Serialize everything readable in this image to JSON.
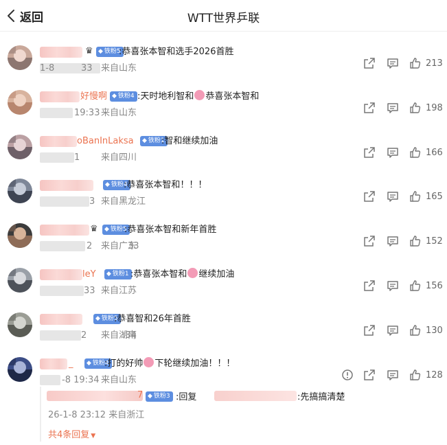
{
  "header": {
    "back_label": "返回",
    "title": "WTT世界乒联"
  },
  "comments": [
    {
      "name_visible": "",
      "fan_badge": "铁粉5",
      "text": ":恭喜张本智和选手2026首胜",
      "time_visible": "1-8",
      "time_visible2": "33",
      "location": "来自山东",
      "likes": "213"
    },
    {
      "name_visible": "好慢啊",
      "fan_badge": "铁粉4",
      "text_a": ":天时地利智和",
      "text_b": "恭喜张本智和",
      "time_visible": "19:33",
      "location": "来自山东",
      "likes": "198"
    },
    {
      "name_visible": "oBanInLaksa",
      "fan_badge": "铁粉1",
      "text": ":智和继续加油",
      "time_visible": "1",
      "location": "来自四川",
      "likes": "166"
    },
    {
      "name_visible": "",
      "fan_badge": "铁粉4",
      "text": ":恭喜张本智和！！！",
      "time_visible": "3",
      "location": "来自黑龙江",
      "likes": "165"
    },
    {
      "name_visible": "",
      "fan_badge": "铁粉5",
      "text": ":恭喜张本智和新年首胜",
      "time_visible": "2",
      "time_visible2": "33",
      "location": "来自广东",
      "likes": "152"
    },
    {
      "name_visible": "leY",
      "fan_badge": "铁粉1",
      "text_a": ":恭喜张本智和",
      "text_b": "继续加油",
      "time_visible": "33",
      "location": "来自江苏",
      "likes": "156"
    },
    {
      "name_visible": "",
      "fan_badge": "铁粉5",
      "text": ":恭喜智和26年首胜",
      "time_visible": "2",
      "time_visible2": ":34",
      "location": "来自湖南",
      "likes": "130"
    },
    {
      "name_visible": "_",
      "fan_badge": "铁粉4",
      "text_a": ":打的好帅",
      "text_b": "下轮继续加油！！！",
      "time_visible": "-8 19:34",
      "location": "来自山东",
      "likes": "128"
    }
  ],
  "reply": {
    "name_visible": "7",
    "fan_badge": "铁粉3",
    "text_a": ":回复",
    "text_b": ":先搞搞清楚",
    "time": "26-1-8 23:12",
    "location": "来自浙江",
    "more_label": "共4条回复"
  },
  "icons": {
    "back": "chevron-left-icon",
    "share": "share-icon",
    "comment": "comment-icon",
    "like": "thumbs-up-icon",
    "report": "report-icon",
    "crown": "crown-icon",
    "diamond": "diamond-icon"
  },
  "colors": {
    "username": "#eb7350",
    "badge": "#5d8ee0",
    "meta": "#888888"
  }
}
